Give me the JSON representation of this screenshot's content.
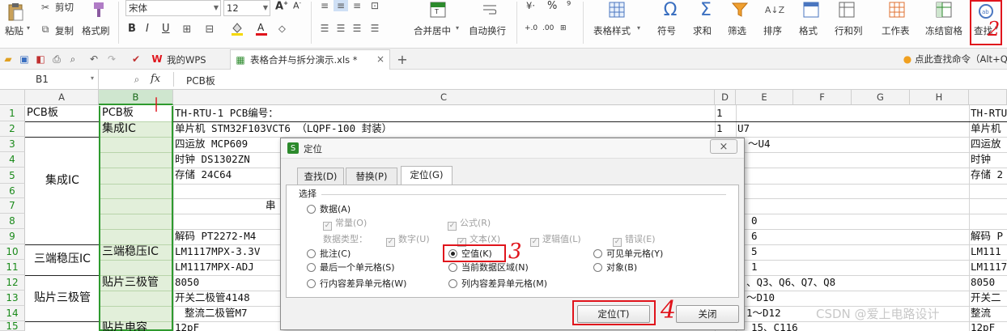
{
  "ribbon": {
    "clipboard": {
      "paste": "粘贴",
      "cut": "剪切",
      "copy": "复制",
      "format_painter": "格式刷"
    },
    "font": {
      "name": "宋体",
      "size": "12"
    },
    "groups": [
      {
        "label": "合并居中"
      },
      {
        "label": "自动换行"
      },
      {
        "label": "表格样式"
      },
      {
        "label": "符号"
      },
      {
        "label": "求和"
      },
      {
        "label": "筛选"
      },
      {
        "label": "排序"
      },
      {
        "label": "格式"
      },
      {
        "label": "行和列"
      },
      {
        "label": "工作表"
      },
      {
        "label": "冻结窗格"
      },
      {
        "label": "查找"
      }
    ]
  },
  "tabs": {
    "wps": "我的WPS",
    "file": "表格合并与拆分演示.xls *",
    "tip": "点此查找命令（Alt+Q"
  },
  "formula_bar": {
    "cell_ref": "B1",
    "fx": "fx",
    "value": "PCB板"
  },
  "columns": [
    "A",
    "B",
    "C",
    "D",
    "E",
    "F",
    "G",
    "H"
  ],
  "rows": [
    "1",
    "2",
    "3",
    "4",
    "5",
    "6",
    "7",
    "8",
    "9",
    "10",
    "11",
    "12",
    "13",
    "14",
    "15"
  ],
  "cells": {
    "a1": "PCB板",
    "b1": "PCB板",
    "c1": "TH-RTU-1    PCB编号：",
    "d1": "1",
    "i1": "TH-RTU-",
    "b2": "集成IC",
    "c2": "单片机 STM32F103VCT6       （LQPF-100 封装）",
    "d2": "1",
    "e2": "U7",
    "i2": "单片机",
    "a_ic": "集成IC",
    "c3": "四运放  MCP609",
    "e3": "～U4",
    "i3": "四运放",
    "c4": "时钟  DS1302ZN",
    "i4": "时钟",
    "c5": "存储 24C64",
    "i5": "存储 2",
    "c7": "串",
    "e8": "0",
    "c9": "解码 PT2272-M4",
    "e9": "6",
    "i9": "解码 P",
    "a_wy": "三端稳压IC",
    "b10": "三端稳压IC",
    "c10": " LM1117MPX-3.3V",
    "e10": "5",
    "i10": " LM111",
    "c11": "LM1117MPX-ADJ",
    "e11": "1",
    "i11": "LM1117",
    "a_tp": "贴片三极管",
    "b12": "贴片三极管",
    "c12": "8050",
    "e12": "、Q3、Q6、Q7、Q8",
    "i12": "8050",
    "c13": "开关二极管4148",
    "e13": "～D10",
    "i13": "开关二",
    "c14": "  整流二极管M7",
    "e14": "1～D12",
    "i14": " 整流",
    "b15": "贴片电容",
    "c15": "12pF",
    "e15": "15、C116",
    "i15": "12pF"
  },
  "dialog": {
    "title": "定位",
    "tabs": [
      "查找(D)",
      "替换(P)",
      "定位(G)"
    ],
    "group_label": "选择",
    "options": {
      "data": "数据(A)",
      "constant": "常量(O)",
      "formula": "公式(R)",
      "data_type": "数据类型：",
      "number": "数字(U)",
      "text": "文本(X)",
      "logical": "逻辑值(L)",
      "error": "错误(E)",
      "comment": "批注(C)",
      "blank": "空值(K)",
      "visible": "可见单元格(Y)",
      "last_cell": "最后一个单元格(S)",
      "current_region": "当前数据区域(N)",
      "object": "对象(B)",
      "row_diff": "行内容差异单元格(W)",
      "col_diff": "列内容差异单元格(M)"
    },
    "goto_button": "定位(T)",
    "close_button": "关闭"
  },
  "annotations": {
    "n2": "2",
    "n3": "3",
    "n4": "4"
  },
  "watermark": "CSDN @爱上电路设计",
  "colors": {
    "accent_red": "#e0141c",
    "selection_green": "#2e9a2e",
    "cell_fill": "#e2efda"
  }
}
